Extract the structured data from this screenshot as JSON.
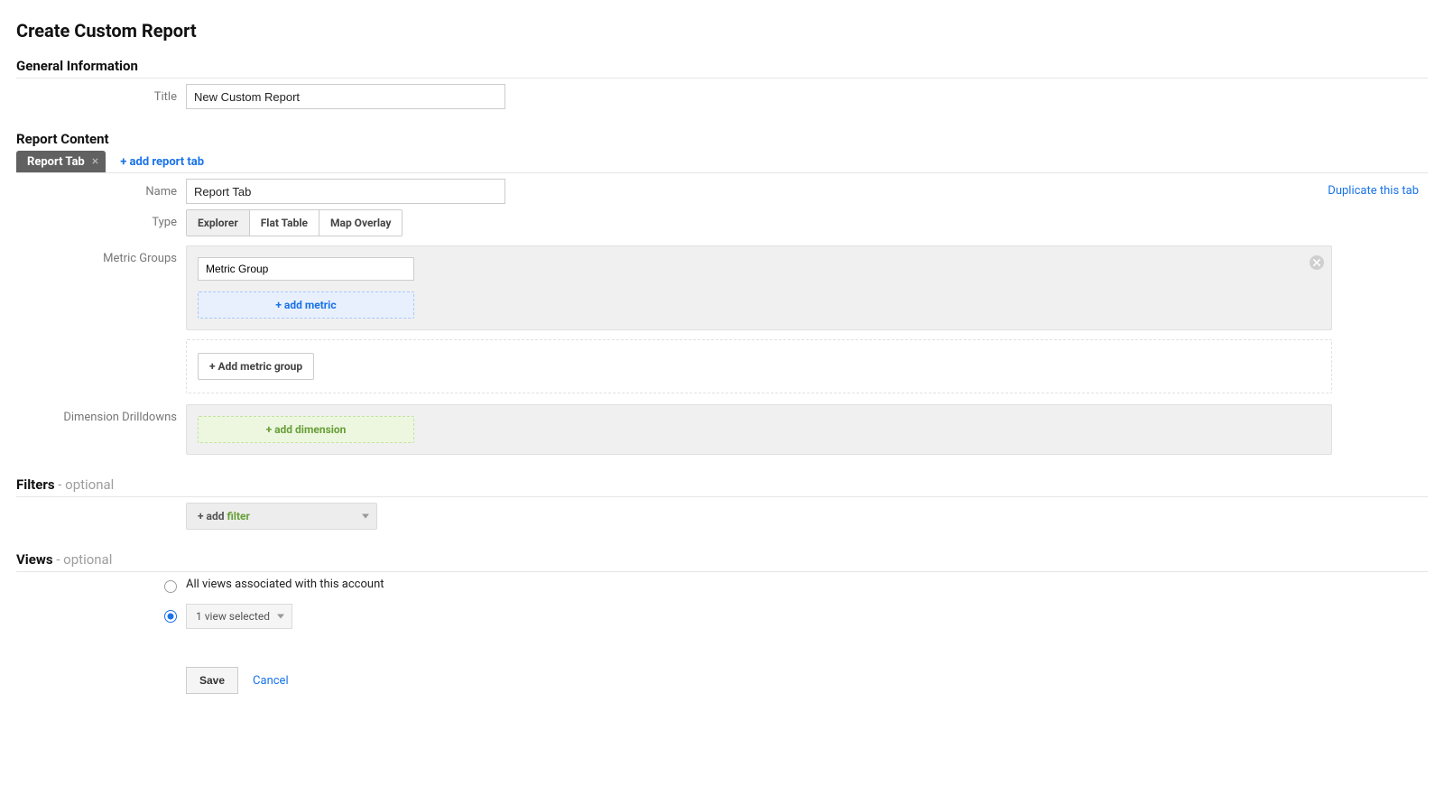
{
  "page_title": "Create Custom Report",
  "sections": {
    "general": {
      "heading": "General Information",
      "title_label": "Title",
      "title_value": "New Custom Report"
    },
    "content": {
      "heading": "Report Content",
      "tab_chip": "Report Tab",
      "add_tab_link": "+ add report tab",
      "duplicate_link": "Duplicate this tab",
      "name_label": "Name",
      "name_value": "Report Tab",
      "type_label": "Type",
      "type_options": [
        "Explorer",
        "Flat Table",
        "Map Overlay"
      ],
      "type_active": "Explorer",
      "metric_groups_label": "Metric Groups",
      "metric_group_name": "Metric Group",
      "add_metric_label": "+ add metric",
      "add_metric_group_label": "+ Add metric group",
      "dimension_label": "Dimension Drilldowns",
      "add_dimension_label": "+ add dimension"
    },
    "filters": {
      "heading": "Filters",
      "suffix": " - optional",
      "add_prefix": "+ add ",
      "add_word": "filter"
    },
    "views": {
      "heading": "Views",
      "suffix": " - optional",
      "option_all": "All views associated with this account",
      "option_selected": "1 view selected"
    }
  },
  "actions": {
    "save": "Save",
    "cancel": "Cancel"
  }
}
